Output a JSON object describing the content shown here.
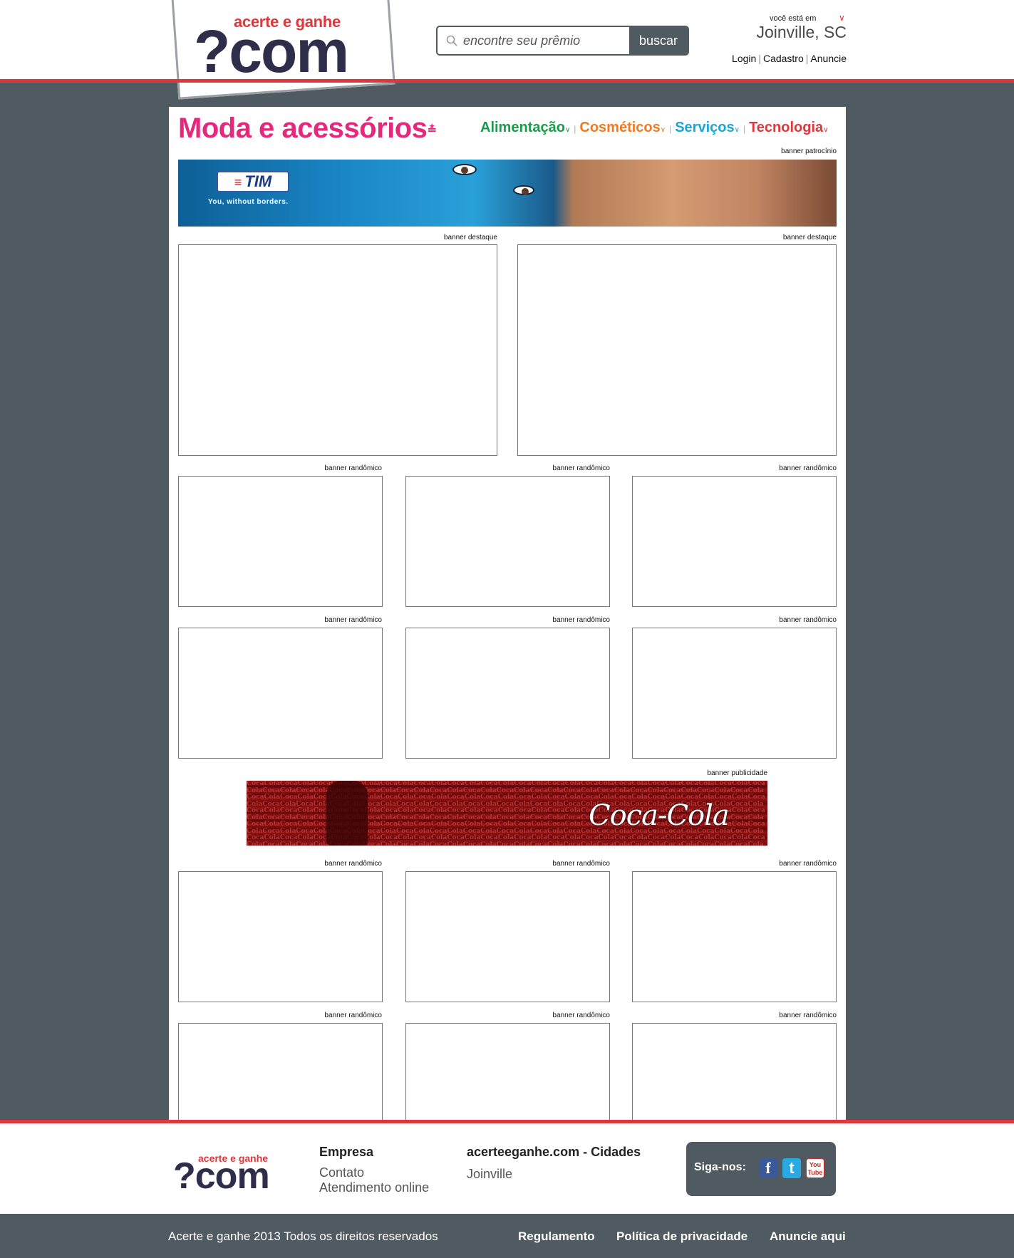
{
  "header": {
    "logo_tagline": "acerte e ganhe",
    "logo_main": "?com",
    "search_placeholder": "encontre seu prêmio",
    "search_button": "buscar",
    "location_label": "você está em",
    "location_city": "Joinville, SC",
    "links": [
      "Login",
      "Cadastro",
      "Anuncie"
    ]
  },
  "category": {
    "title": "Moda e acessórios",
    "nav": [
      {
        "label": "Alimentação",
        "color": "#1a9a4a"
      },
      {
        "label": "Cosméticos",
        "color": "#f07b22"
      },
      {
        "label": "Serviços",
        "color": "#1ba6d8"
      },
      {
        "label": "Tecnologia",
        "color": "#e0373c"
      }
    ]
  },
  "banners": {
    "sponsor_label": "banner patrocínio",
    "featured_label": "banner destaque",
    "random_label": "banner randômico",
    "ad_label": "banner publicidade",
    "sponsor_brand": "TIM",
    "sponsor_tagline": "You, without borders.",
    "ad_brand": "Coca-Cola"
  },
  "footer": {
    "logo_tagline": "acerte e ganhe",
    "logo_main": "?com",
    "col1_title": "Empresa",
    "col1_links": [
      "Contato",
      "Atendimento online"
    ],
    "col2_title": "acerteeganhe.com - Cidades",
    "col2_links": [
      "Joinville"
    ],
    "social_label": "Siga-nos:",
    "copyright": "Acerte e ganhe 2013 Todos os direitos reservados",
    "bottom_links": [
      "Regulamento",
      "Política de privacidade",
      "Anuncie aqui"
    ]
  },
  "colors": {
    "accent": "#e0373c",
    "dark": "#4f5a61",
    "category": "#e6287d"
  }
}
